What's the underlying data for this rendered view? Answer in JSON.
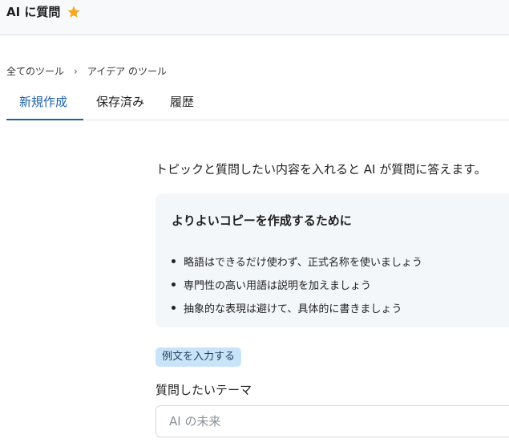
{
  "header": {
    "title": "AI に質問",
    "star_color": "#f5a623"
  },
  "breadcrumb": {
    "items": [
      "全てのツール",
      "アイデア のツール"
    ],
    "separator": "›"
  },
  "tabs": [
    {
      "label": "新規作成",
      "active": true
    },
    {
      "label": "保存済み",
      "active": false
    },
    {
      "label": "履歴",
      "active": false
    }
  ],
  "main": {
    "description": "トピックと質問したい内容を入れると AI が質問に答えます。",
    "tips": {
      "title": "よりよいコピーを作成するために",
      "items": [
        "略語はできるだけ使わず、正式名称を使いましょう",
        "専門性の高い用語は説明を加えましょう",
        "抽象的な表現は避けて、具体的に書きましょう"
      ]
    },
    "example_button": "例文を入力する",
    "theme_field": {
      "label": "質問したいテーマ",
      "placeholder": "AI の未来",
      "value": ""
    }
  },
  "colors": {
    "accent": "#1d5fa8",
    "example_button_bg": "#c9e4f8",
    "tip_box_bg": "#f4f7fa"
  }
}
